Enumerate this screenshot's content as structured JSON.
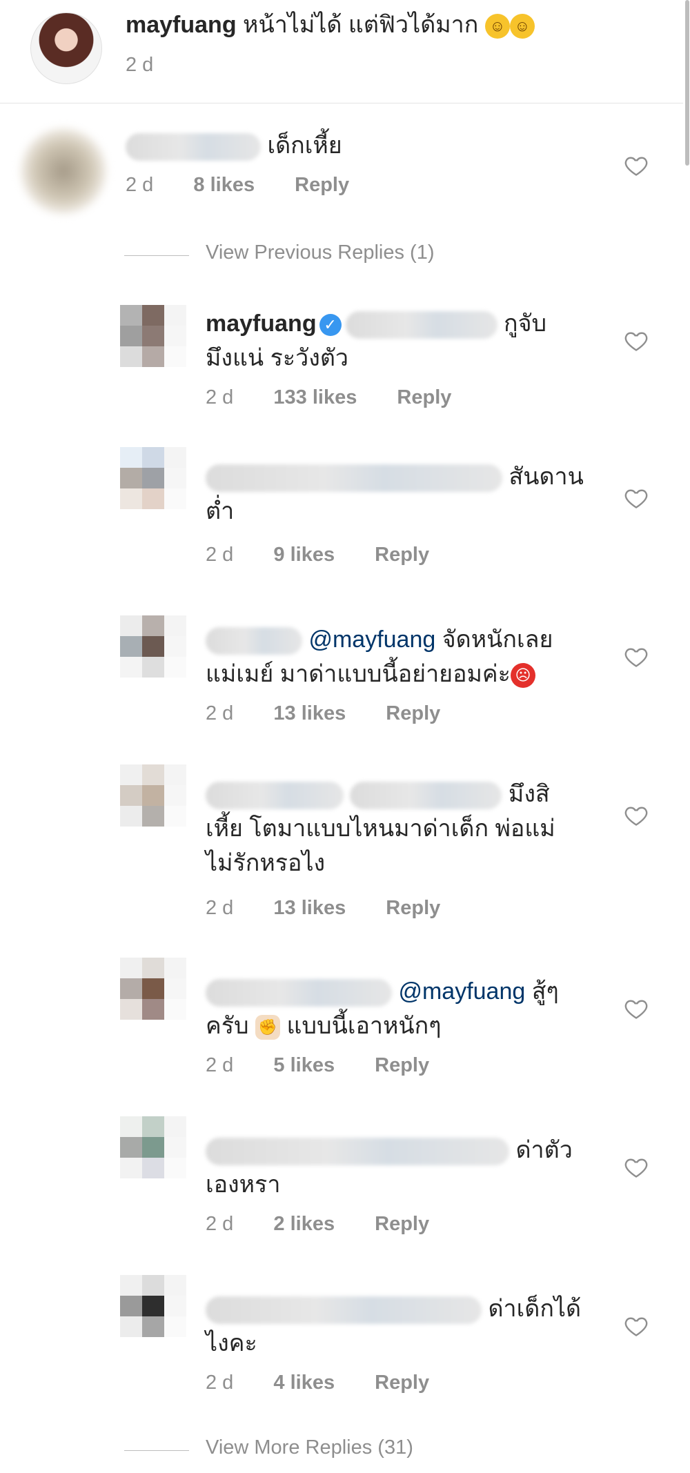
{
  "caption": {
    "username": "mayfuang",
    "text": "หน้าไม่ได้ แต่ฟิวได้มาก",
    "emojis": [
      "laughing-crying",
      "laughing-crying"
    ],
    "time": "2 d"
  },
  "first_comment": {
    "text": "เด็กเหี้ย",
    "time": "2 d",
    "likes": "8 likes",
    "reply": "Reply"
  },
  "view_previous": "View Previous Replies (1)",
  "replies": [
    {
      "username": "mayfuang",
      "verified": true,
      "line1_end": "กูจับ",
      "line2": "มึงแน่ ระวังตัว",
      "time": "2 d",
      "likes": "133 likes",
      "reply": "Reply"
    },
    {
      "line1_end": "สันดาน",
      "line2": "ต่ำ",
      "time": "2 d",
      "likes": "9 likes",
      "reply": "Reply"
    },
    {
      "mention": "@mayfuang",
      "line1_end": "จัดหนักเลย",
      "line2": "แม่เมย์ มาด่าแบบนี้อย่ายอมค่ะ",
      "emoji": "angry-face",
      "time": "2 d",
      "likes": "13 likes",
      "reply": "Reply"
    },
    {
      "line1_end": "มึงสิ",
      "line2": "เหี้ย โตมาแบบไหนมาด่าเด็ก พ่อแม่",
      "line3": "ไม่รักหรอไง",
      "time": "2 d",
      "likes": "13 likes",
      "reply": "Reply"
    },
    {
      "mention": "@mayfuang",
      "line1_end": "สู้ๆ",
      "line2_a": "ครับ",
      "emoji": "fist",
      "line2_b": "แบบนี้เอาหนักๆ",
      "time": "2 d",
      "likes": "5 likes",
      "reply": "Reply"
    },
    {
      "line1_end": "ด่าตัว",
      "line2": "เองหรา",
      "time": "2 d",
      "likes": "2 likes",
      "reply": "Reply"
    },
    {
      "line1_end": "ด่าเด็กได้",
      "line2": "ไงคะ",
      "time": "2 d",
      "likes": "4 likes",
      "reply": "Reply"
    }
  ],
  "view_more": "View More Replies (31)",
  "icons": {
    "heart": "heart-outline-icon",
    "verified": "verified-badge-icon"
  },
  "colors": {
    "mention": "#003569",
    "verified": "#3897f0",
    "meta": "#8e8e8e"
  }
}
